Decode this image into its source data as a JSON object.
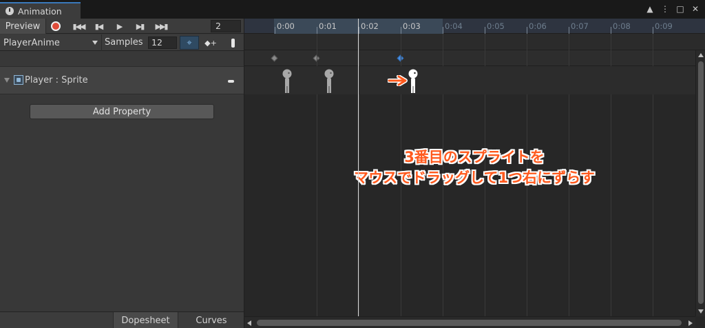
{
  "window": {
    "tab_title": "Animation",
    "icons": [
      "lock-icon",
      "more-icon",
      "maximize-icon",
      "close-icon"
    ]
  },
  "toolbar": {
    "preview_label": "Preview",
    "frame_value": "2",
    "clip_name": "PlayerAnime",
    "samples_label": "Samples",
    "samples_value": "12"
  },
  "property": {
    "label": "Player : Sprite",
    "add_property_label": "Add Property"
  },
  "bottom_tabs": {
    "dopesheet": "Dopesheet",
    "curves": "Curves"
  },
  "timeline": {
    "ticks": [
      "0:00",
      "0:01",
      "0:02",
      "0:03",
      "0:04",
      "0:05",
      "0:06",
      "0:07",
      "0:08",
      "0:09"
    ],
    "current_frame": 2,
    "keyframes": [
      "0:00",
      "0:01",
      "0:03"
    ],
    "selected_keyframe": "0:03"
  },
  "annotation": {
    "line1": "3番目のスプライトを",
    "line2": "マウスでドラッグして1つ右にずらす",
    "arrow_color": "#ff5a1e"
  },
  "colors": {
    "record": "#e04c3a",
    "selection": "#4a8ee0",
    "annotation": "#ff5a1e"
  }
}
